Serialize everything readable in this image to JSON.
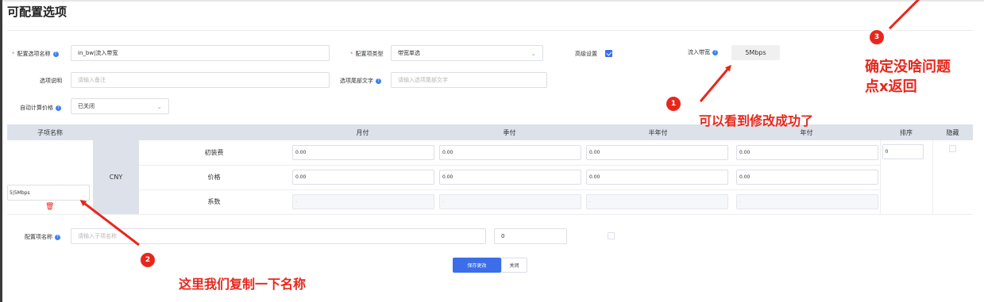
{
  "page": {
    "title": "可配置选项"
  },
  "form": {
    "option_name_label": "配置选项名称",
    "option_name_value": "in_bw|流入带宽",
    "option_type_label": "配置项类型",
    "option_type_value": "带宽单选",
    "advanced_label": "高级设置",
    "advanced_checked": true,
    "inbound_bw_label": "流入带宽",
    "inbound_bw_value": "5Mbps",
    "desc_label": "选项说明",
    "desc_placeholder": "请输入备注",
    "footer_text_label": "选项尾部文字",
    "footer_text_placeholder": "请输入选项尾部文字",
    "auto_price_label": "自动计算价格",
    "auto_price_value": "已关闭"
  },
  "table": {
    "headers": [
      "子项名称",
      "月付",
      "季付",
      "半年付",
      "年付",
      "排序",
      "隐藏"
    ],
    "currency": "CNY",
    "rows": [
      {
        "label": "初装费",
        "values": [
          "0.00",
          "0.00",
          "0.00",
          "0.00"
        ]
      },
      {
        "label": "价格",
        "values": [
          "0.00",
          "0.00",
          "0.00",
          "0.00"
        ]
      },
      {
        "label": "系数",
        "values": [
          "-",
          "-",
          "-",
          "-"
        ]
      }
    ],
    "sub_item_name": "5|5Mbps",
    "sort_value": "0"
  },
  "new_item": {
    "label": "配置项名称",
    "placeholder": "请输入子项名称",
    "sort_value": "0"
  },
  "buttons": {
    "save": "保存更改",
    "close": "关闭"
  },
  "annotations": {
    "step1_num": "1",
    "step1_text": "可以看到修改成功了",
    "step2_num": "2",
    "step2_text": "这里我们复制一下名称",
    "step3_num": "3",
    "step3_text_line1": "确定没啥问题",
    "step3_text_line2": "点x返回"
  },
  "colors": {
    "accent": "#3b6ee8",
    "annotation": "#e8271c",
    "table_header": "#dde1ea"
  }
}
